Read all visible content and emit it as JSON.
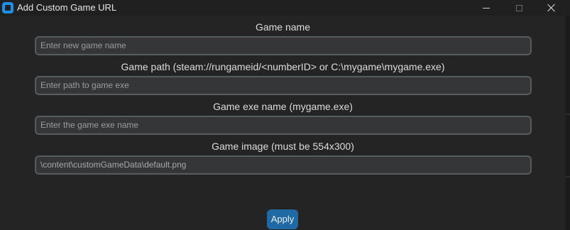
{
  "window": {
    "title": "Add Custom Game URL",
    "controls": {
      "minimize": "minimize-icon",
      "maximize": "maximize-icon",
      "close": "close-icon"
    }
  },
  "form": {
    "game_name": {
      "label": "Game name",
      "placeholder": "Enter new game name",
      "value": ""
    },
    "game_path": {
      "label": "Game path (steam://rungameid/<numberID> or C:\\mygame\\mygame.exe)",
      "placeholder": "Enter path to game exe",
      "value": ""
    },
    "game_exe": {
      "label": "Game exe name (mygame.exe)",
      "placeholder": "Enter the game exe name",
      "value": ""
    },
    "game_image": {
      "label": "Game image (must be 554x300)",
      "placeholder": "",
      "value": "\\content\\customGameData\\default.png"
    },
    "apply_label": "Apply"
  },
  "colors": {
    "background": "#242424",
    "titlebar": "#202020",
    "field_bg": "#343638",
    "field_border": "#565b5e",
    "accent": "#1f6aa5",
    "app_icon": "#1e8fe6"
  }
}
